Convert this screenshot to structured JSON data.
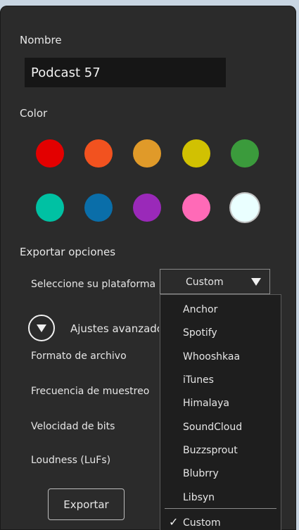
{
  "name_section": {
    "label": "Nombre",
    "value": "Podcast 57"
  },
  "color_section": {
    "label": "Color",
    "swatches": [
      "#e30000",
      "#f2521f",
      "#e09a29",
      "#d1c102",
      "#3b9b3c",
      "#00c1a3",
      "#0a6ea9",
      "#9a29b9",
      "#ff6ab7",
      "#eaffff"
    ]
  },
  "export_section": {
    "label": "Exportar opciones",
    "platform_label": "Seleccione su plataforma",
    "platform_value": "Custom",
    "advanced_label": "Ajustes avanzados",
    "format_label": "Formato de archivo",
    "sample_rate_label": "Frecuencia de muestreo",
    "bitrate_label": "Velocidad de bits",
    "loudness_label": "Loudness (LuFs)",
    "export_button": "Exportar"
  },
  "platform_menu": {
    "items": [
      "Anchor",
      "Spotify",
      "Whooshkaa",
      "iTunes",
      "Himalaya",
      "SoundCloud",
      "Buzzsprout",
      "Blubrry",
      "Libsyn"
    ],
    "checked_item": "Custom",
    "check_mark": "✓"
  }
}
